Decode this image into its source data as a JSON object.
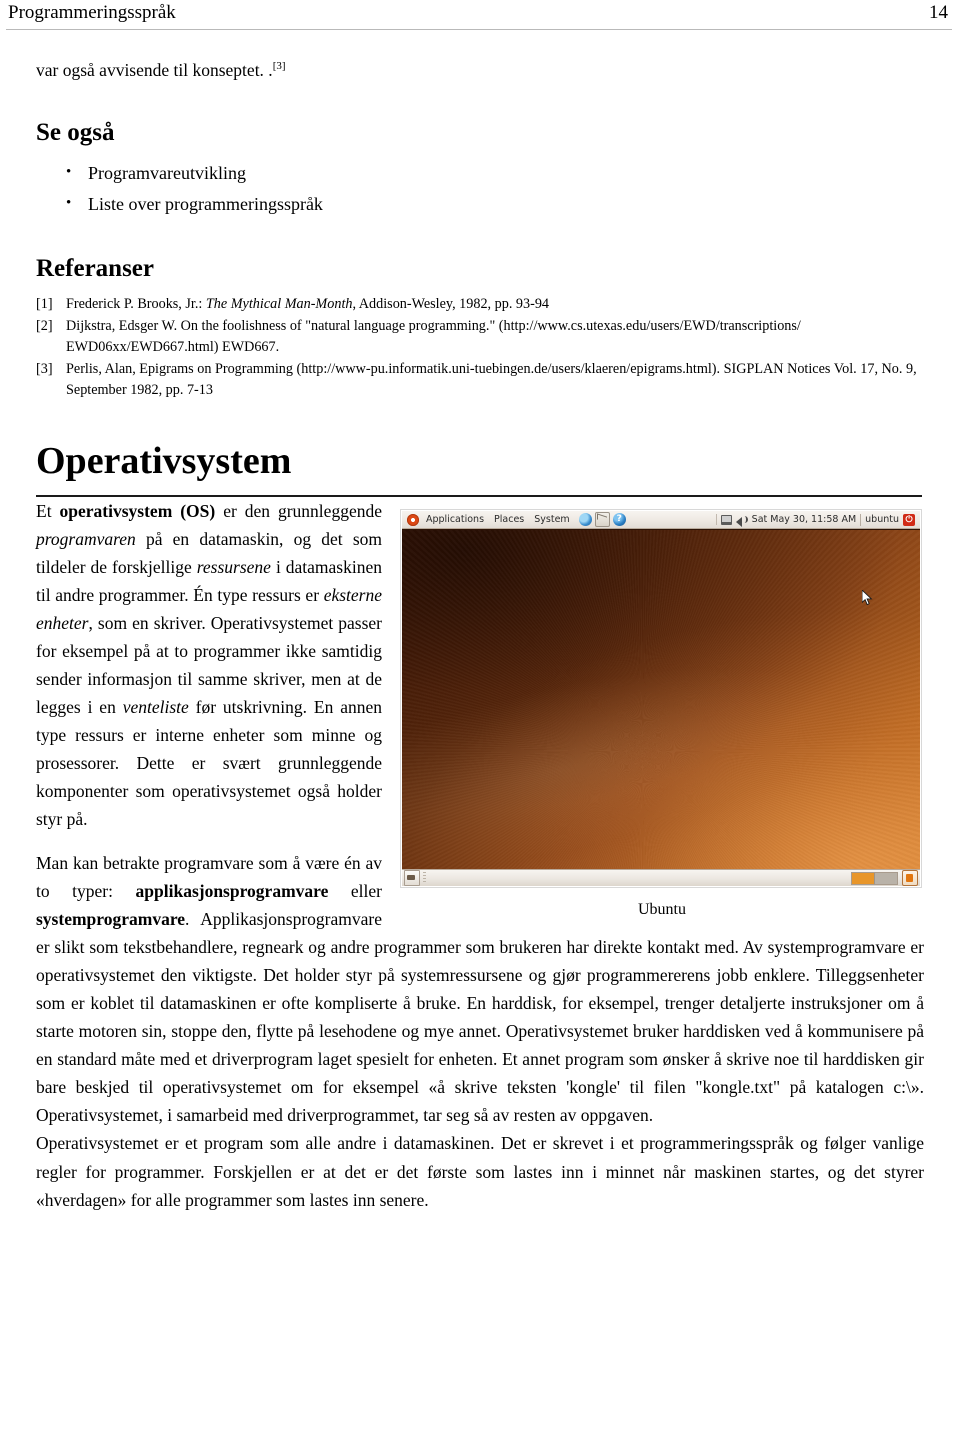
{
  "header": {
    "title": "Programmeringsspråk",
    "page_number": "14"
  },
  "continuation_line": {
    "text": "var også avvisende til konseptet. .",
    "ref_marker": "[3]"
  },
  "see_also": {
    "heading": "Se også",
    "bullet_glyph": "•",
    "items": [
      "Programvareutvikling",
      "Liste over programmeringsspråk"
    ]
  },
  "references": {
    "heading": "Referanser",
    "items": [
      {
        "num": "[1]",
        "pre": "Frederick P. Brooks, Jr.: ",
        "italic": "The Mythical Man-Month",
        "post": ", Addison-Wesley, 1982, pp. 93-94"
      },
      {
        "num": "[2]",
        "pre": "Dijkstra, Edsger W. On the foolishness of \"natural language programming.\" (http://www.cs.utexas.edu/users/EWD/transcriptions/",
        "italic": "",
        "post": "EWD06xx/EWD667.html) EWD667."
      },
      {
        "num": "[3]",
        "pre": "Perlis, Alan, Epigrams on Programming (http://www-pu.informatik.uni-tuebingen.de/users/klaeren/epigrams.html). SIGPLAN Notices",
        "italic": "",
        "post": "Vol. 17, No. 9, September 1982, pp. 7-13"
      }
    ]
  },
  "article": {
    "title": "Operativsystem",
    "paragraph1": {
      "seg1": "Et ",
      "bold1": "operativsystem (OS)",
      "seg2": " er den grunnleggende ",
      "italic1": "programvaren",
      "seg3": " på en datamaskin, og det som tildeler de forskjellige ",
      "italic2": "ressursene",
      "seg4": " i datamaskinen til andre programmer. Én type ressurs er ",
      "italic3": "eksterne enheter",
      "seg5": ", som en skriver. Operativsystemet passer for eksempel på at to programmer ikke samtidig sender informasjon til samme skriver, men at de legges i en ",
      "italic4": "venteliste",
      "seg6": " før utskrivning. En annen type ressurs er interne enheter som minne og prosessorer. Dette er svært grunnleggende komponenter som operativsystemet også holder styr på."
    },
    "paragraph2": {
      "seg1": "Man kan betrakte programvare som å være én av to typer: ",
      "bold1": "applikasjonsprogramvare",
      "seg2": " eller ",
      "bold2": "systemprogramvare",
      "seg3": ". Applikasjonsprogramvare er slikt som tekstbehandlere, regneark og andre programmer som brukeren har direkte kontakt med. Av systemprogramvare er operativsystemet den viktigste. Det holder styr på systemressursene og gjør programmererens jobb enklere. Tilleggsenheter som er koblet til datamaskinen er ofte kompliserte å bruke. En harddisk, for eksempel, trenger detaljerte instruksjoner om å starte motoren sin, stoppe den, flytte på lesehodene og mye annet. Operativsystemet bruker harddisken ved å kommunisere på en standard måte med et driverprogram laget spesielt for enheten. Et annet program som ønsker å skrive noe til harddisken gir bare beskjed til operativsystemet om for eksempel «å skrive teksten 'kongle' til filen \"kongle.txt\" på katalogen c:\\». Operativsystemet, i samarbeid med driverprogrammet, tar seg så av resten av oppgaven."
    },
    "paragraph3": {
      "text": "Operativsystemet er et program som alle andre i datamaskinen. Det er skrevet i et programmeringsspråk og følger vanlige regler for programmer. Forskjellen er at det er det første som lastes inn i minnet når maskinen startes, og det styrer «hverdagen» for alle programmer som lastes inn senere."
    }
  },
  "figure": {
    "caption": "Ubuntu",
    "screenshot": {
      "top_panel": {
        "logo_icon": "ubuntu-logo-icon",
        "menus": [
          "Applications",
          "Places",
          "System"
        ],
        "launchers": [
          "firefox-icon",
          "mail-icon",
          "help-icon"
        ],
        "tray": {
          "monitor_icon": "monitor-icon",
          "volume_icon": "volume-icon",
          "clock": "Sat May 30, 11:58 AM",
          "user": "ubuntu",
          "power_icon": "power-icon",
          "power_glyph": "⏻"
        }
      },
      "bottom_panel": {
        "show_desktop_icon": "show-desktop-icon",
        "workspaces": [
          "active",
          "idle"
        ],
        "trash_icon": "trash-icon"
      },
      "cursor_icon": "mouse-cursor-icon"
    }
  },
  "colors": {
    "ubuntu_orange": "#dd4814",
    "desktop_brown": "#8a4417",
    "panel_grey": "#efeae4",
    "workspace_active": "#e8962a"
  }
}
